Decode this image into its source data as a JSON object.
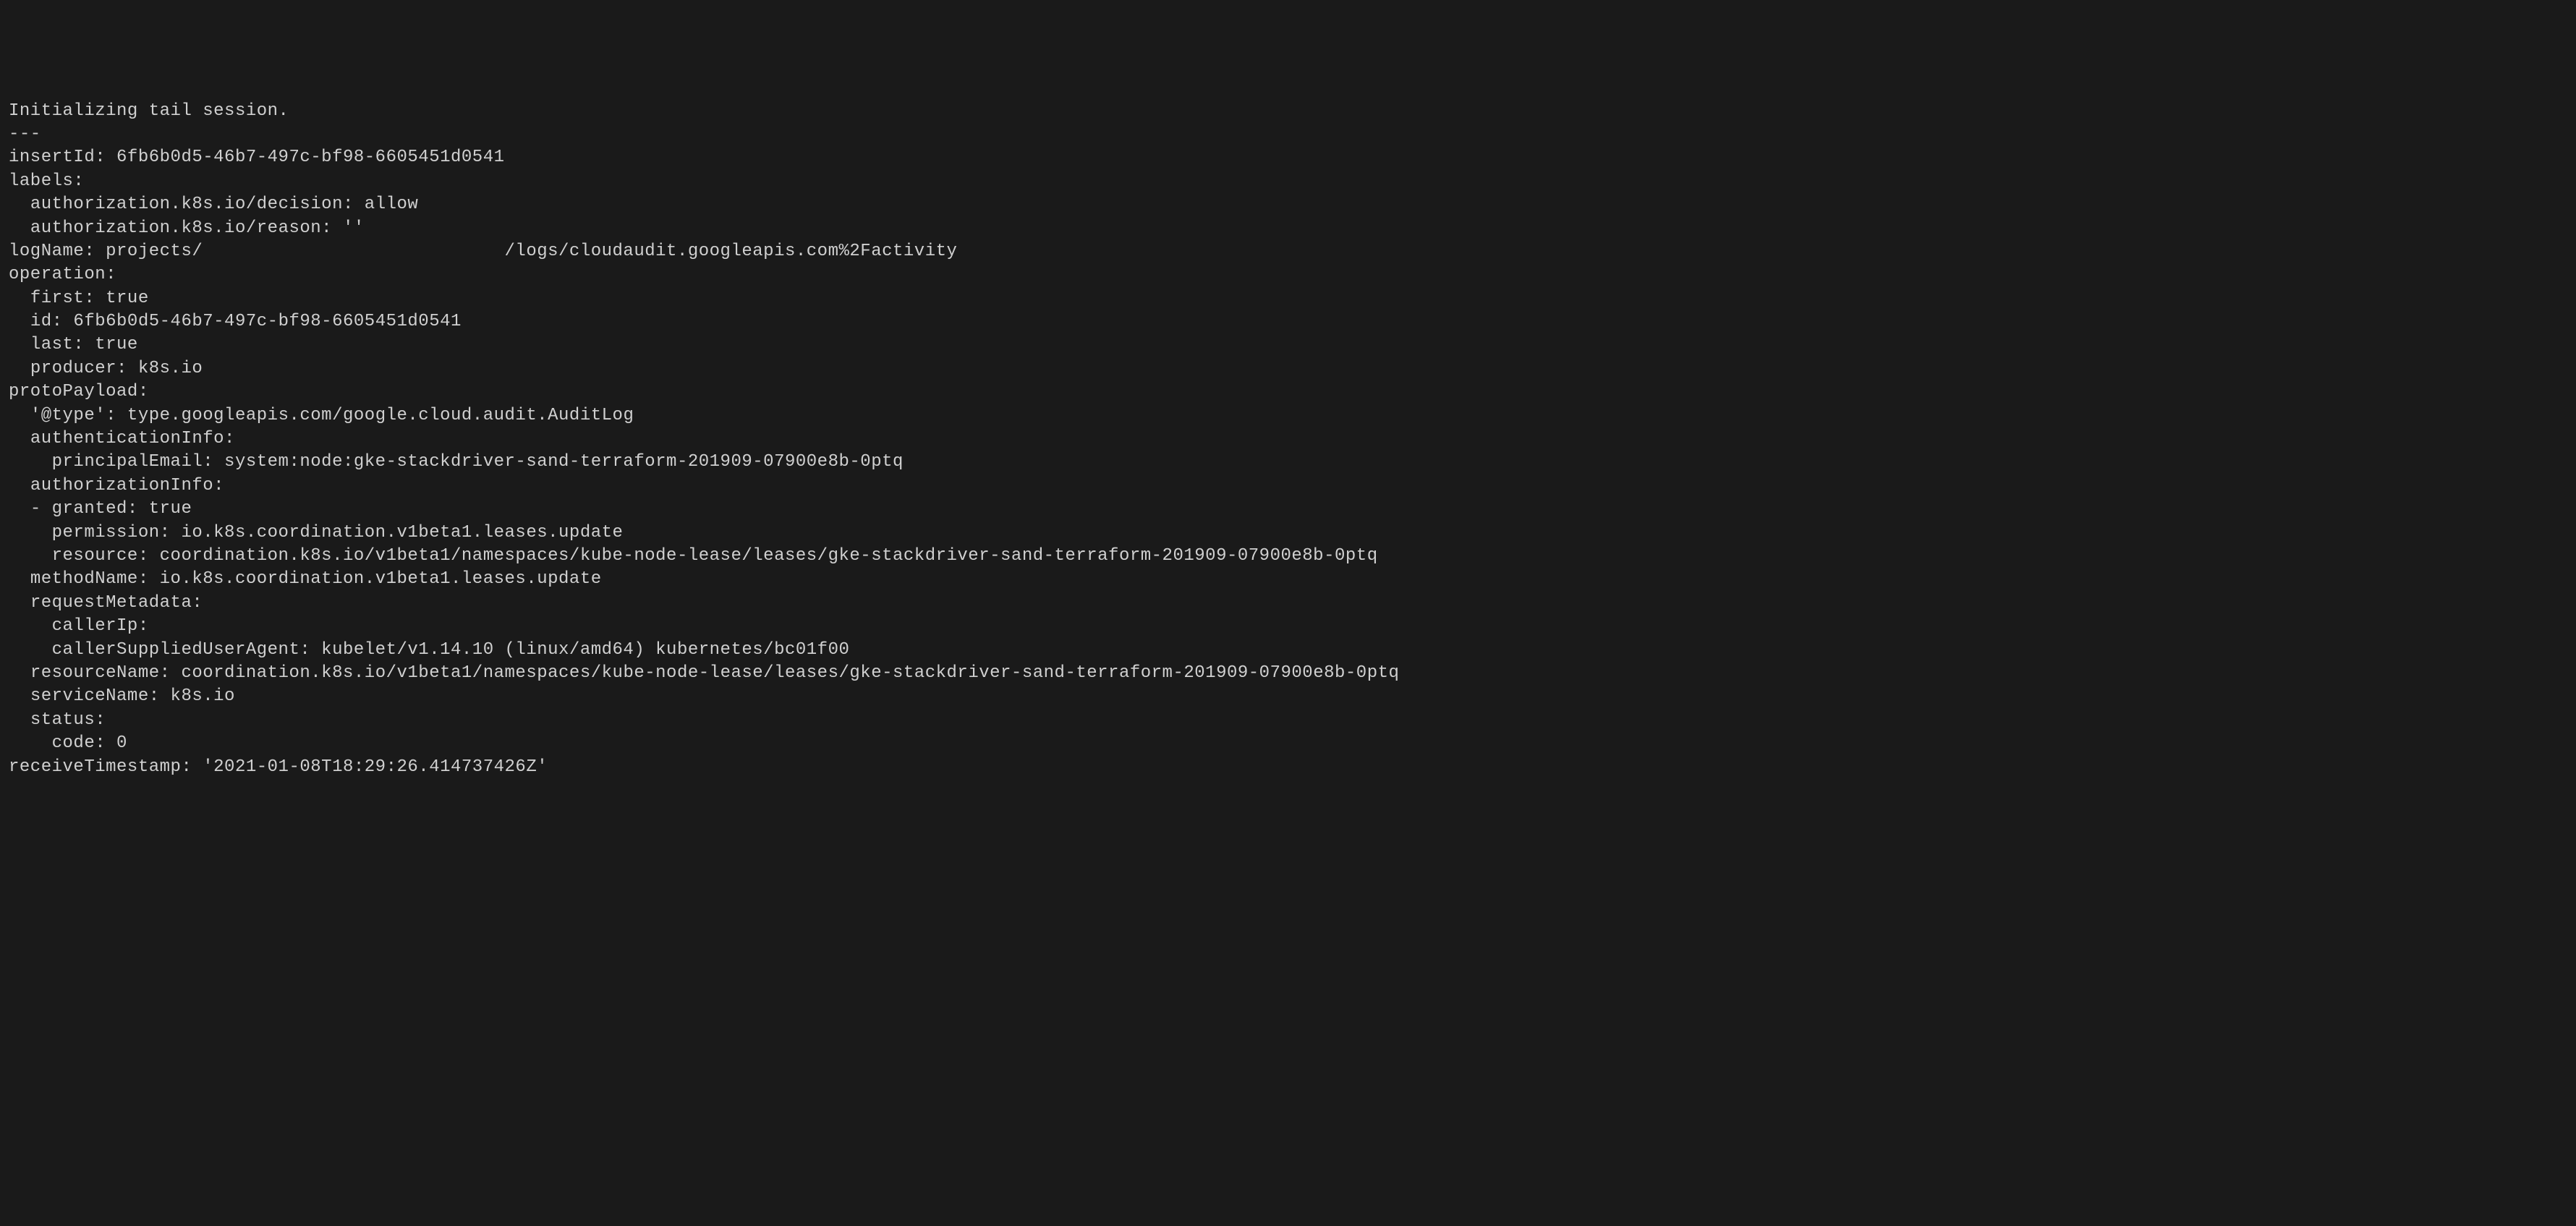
{
  "terminal": {
    "lines": [
      "Initializing tail session.",
      "---",
      "insertId: 6fb6b0d5-46b7-497c-bf98-6605451d0541",
      "labels:",
      "  authorization.k8s.io/decision: allow",
      "  authorization.k8s.io/reason: ''",
      "logName: projects/                            /logs/cloudaudit.googleapis.com%2Factivity",
      "operation:",
      "  first: true",
      "  id: 6fb6b0d5-46b7-497c-bf98-6605451d0541",
      "  last: true",
      "  producer: k8s.io",
      "protoPayload:",
      "  '@type': type.googleapis.com/google.cloud.audit.AuditLog",
      "  authenticationInfo:",
      "    principalEmail: system:node:gke-stackdriver-sand-terraform-201909-07900e8b-0ptq",
      "  authorizationInfo:",
      "  - granted: true",
      "    permission: io.k8s.coordination.v1beta1.leases.update",
      "    resource: coordination.k8s.io/v1beta1/namespaces/kube-node-lease/leases/gke-stackdriver-sand-terraform-201909-07900e8b-0ptq",
      "  methodName: io.k8s.coordination.v1beta1.leases.update",
      "  requestMetadata:",
      "    callerIp:",
      "    callerSuppliedUserAgent: kubelet/v1.14.10 (linux/amd64) kubernetes/bc01f00",
      "  resourceName: coordination.k8s.io/v1beta1/namespaces/kube-node-lease/leases/gke-stackdriver-sand-terraform-201909-07900e8b-0ptq",
      "  serviceName: k8s.io",
      "  status:",
      "    code: 0",
      "receiveTimestamp: '2021-01-08T18:29:26.414737426Z'"
    ]
  }
}
